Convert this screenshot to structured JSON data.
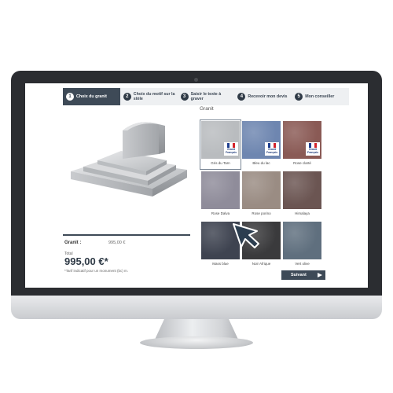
{
  "stepper": {
    "steps": [
      {
        "num": "1",
        "label": "Choix du granit",
        "active": true
      },
      {
        "num": "2",
        "label": "Choix du motif sur la stèle",
        "active": false
      },
      {
        "num": "3",
        "label": "Saisir le texte à graver",
        "active": false
      },
      {
        "num": "4",
        "label": "Recevoir mon devis",
        "active": false
      },
      {
        "num": "5",
        "label": "Mon conseiller",
        "active": false
      }
    ]
  },
  "granite": {
    "title": "Granit",
    "badge_text": "Granit Français",
    "items": [
      {
        "name": "Gris du Tarn",
        "color": "#b9bcbf",
        "badge": true,
        "selected": true
      },
      {
        "name": "Bleu du lac",
        "color": "#6e86b0",
        "badge": true,
        "selected": false
      },
      {
        "name": "Rose clarté",
        "color": "#8a5a55",
        "badge": true,
        "selected": false
      },
      {
        "name": "Rose Dalva",
        "color": "#8f8c9a",
        "badge": false,
        "selected": false
      },
      {
        "name": "Rose porino",
        "color": "#9a8c83",
        "badge": false,
        "selected": false
      },
      {
        "name": "Himalaya",
        "color": "#6b5552",
        "badge": false,
        "selected": false
      },
      {
        "name": "Mass blue",
        "color": "#3e4350",
        "badge": false,
        "selected": false
      },
      {
        "name": "Noir Afrique",
        "color": "#3a3a3c",
        "badge": false,
        "selected": false
      },
      {
        "name": "Vert olive",
        "color": "#5f6f7e",
        "badge": false,
        "selected": false
      }
    ]
  },
  "summary": {
    "granit_label": "Granit :",
    "granit_value": "995,00 €",
    "total_label": "Total",
    "total_price": "995,00 €*",
    "note": "*Tarif indicatif pour un monument (bc) m."
  },
  "actions": {
    "next_label": "Suivant"
  },
  "colors": {
    "accent": "#3e4a57",
    "bezel": "#2b2d31",
    "flag_blue": "#1f3f8f",
    "flag_red": "#d4232b"
  }
}
